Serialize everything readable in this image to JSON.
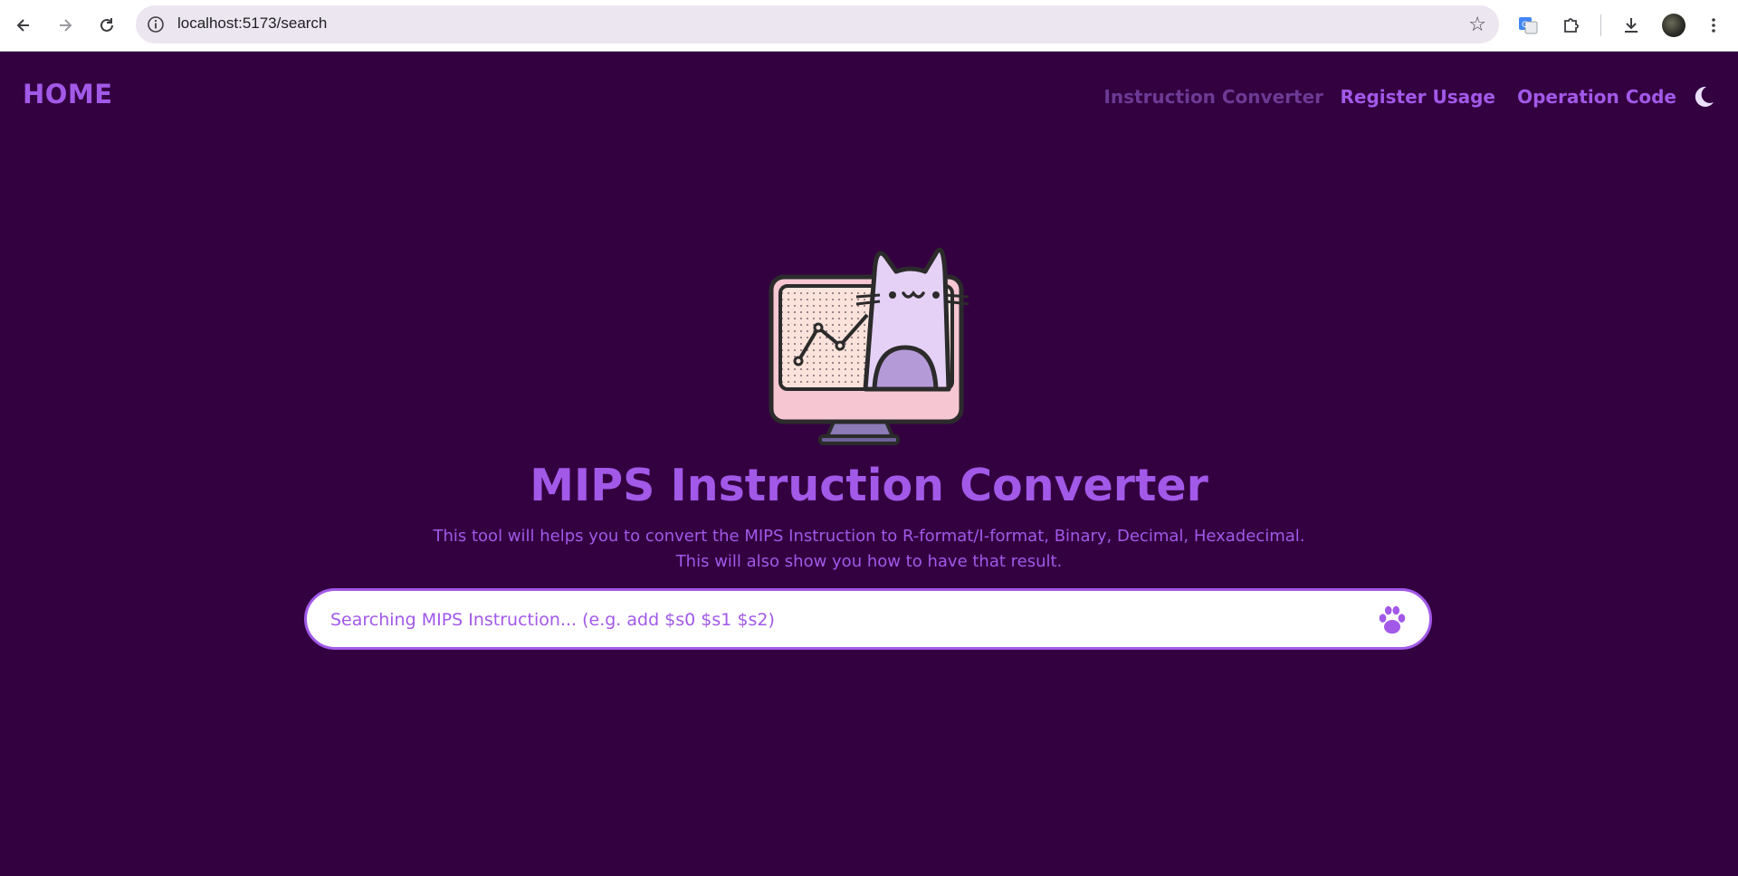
{
  "browser": {
    "url": "localhost:5173/search",
    "back_icon": "arrow-left-icon",
    "forward_icon": "arrow-right-icon",
    "reload_icon": "reload-icon"
  },
  "header": {
    "home_label": "HOME",
    "nav": [
      {
        "label": "Instruction Converter",
        "active": true
      },
      {
        "label": "Register Usage",
        "active": false
      },
      {
        "label": "Operation Code",
        "active": false
      }
    ],
    "theme_icon": "moon-icon"
  },
  "hero": {
    "title": "MIPS Instruction Converter",
    "subtitle_line1": "This tool will helps you to convert the MIPS Instruction to R-format/I-format, Binary, Decimal, Hexadecimal.",
    "subtitle_line2": "This will also show you how to have that result."
  },
  "search": {
    "placeholder": "Searching MIPS Instruction... (e.g. add $s0 $s1 $s2)",
    "value": "",
    "submit_icon": "paw-icon"
  },
  "colors": {
    "background": "#330040",
    "accent": "#a259e8",
    "nav_active": "#6c3a94"
  }
}
